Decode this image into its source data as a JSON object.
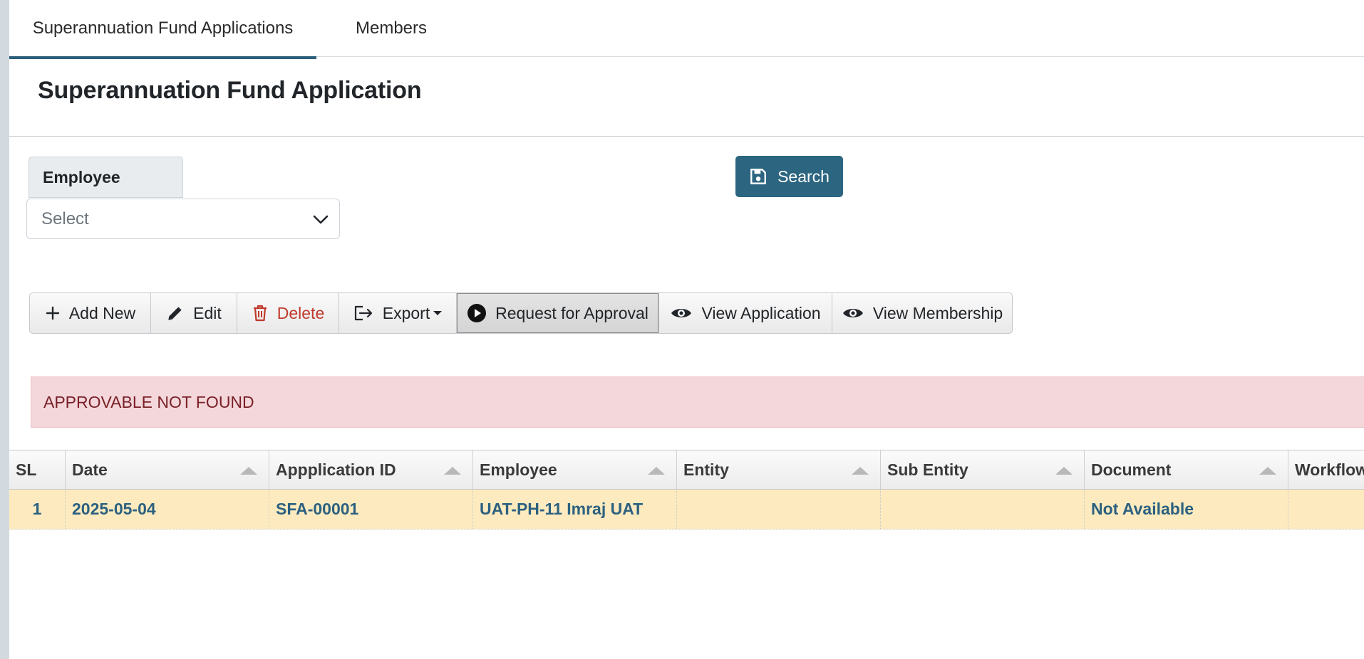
{
  "tabs": [
    {
      "label": "Superannuation Fund Applications",
      "active": true
    },
    {
      "label": "Members",
      "active": false
    }
  ],
  "page": {
    "title": "Superannuation Fund Application"
  },
  "filter": {
    "employee_label": "Employee",
    "employee_select_value": "Select",
    "search_label": "Search"
  },
  "toolbar": {
    "add_new": "Add New",
    "edit": "Edit",
    "delete": "Delete",
    "export": "Export",
    "request_approval": "Request for Approval",
    "view_application": "View Application",
    "view_membership": "View Membership"
  },
  "alert": {
    "message": "APPROVABLE NOT FOUND"
  },
  "table": {
    "columns": [
      "SL",
      "Date",
      "Appplication ID",
      "Employee",
      "Entity",
      "Sub Entity",
      "Document",
      "Workflow"
    ],
    "rows": [
      {
        "sl": "1",
        "date": "2025-05-04",
        "application_id": "SFA-00001",
        "employee": "UAT-PH-11 Imraj UAT",
        "entity": "",
        "sub_entity": "",
        "document": "Not Available",
        "workflow": ""
      }
    ]
  },
  "colors": {
    "primary": "#2c6580",
    "tab_underline": "#2c5f7c",
    "alert_bg": "#f3d7db",
    "selected_row_bg": "#fdebbf",
    "delete_text": "#c0392b"
  }
}
